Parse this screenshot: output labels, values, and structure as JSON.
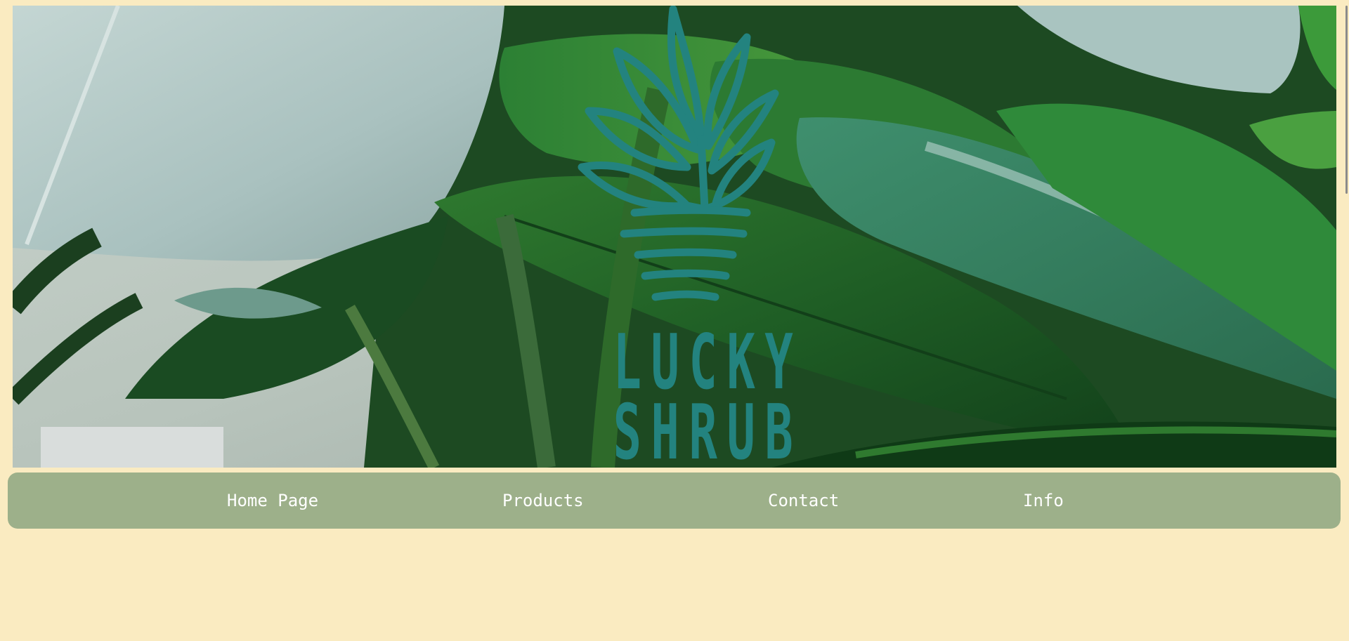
{
  "brand": {
    "line1": "LUCKY",
    "line2": "SHRUB",
    "logo_icon": "shrub-leaf-icon",
    "logo_color": "#23837f"
  },
  "hero": {
    "image": "banana-leaves-photo"
  },
  "nav": {
    "items": [
      {
        "label": "Home Page"
      },
      {
        "label": "Products"
      },
      {
        "label": "Contact"
      },
      {
        "label": "Info"
      }
    ],
    "background": "#9db08a",
    "text_color": "#ffffff"
  },
  "page": {
    "background": "#faebc1"
  }
}
